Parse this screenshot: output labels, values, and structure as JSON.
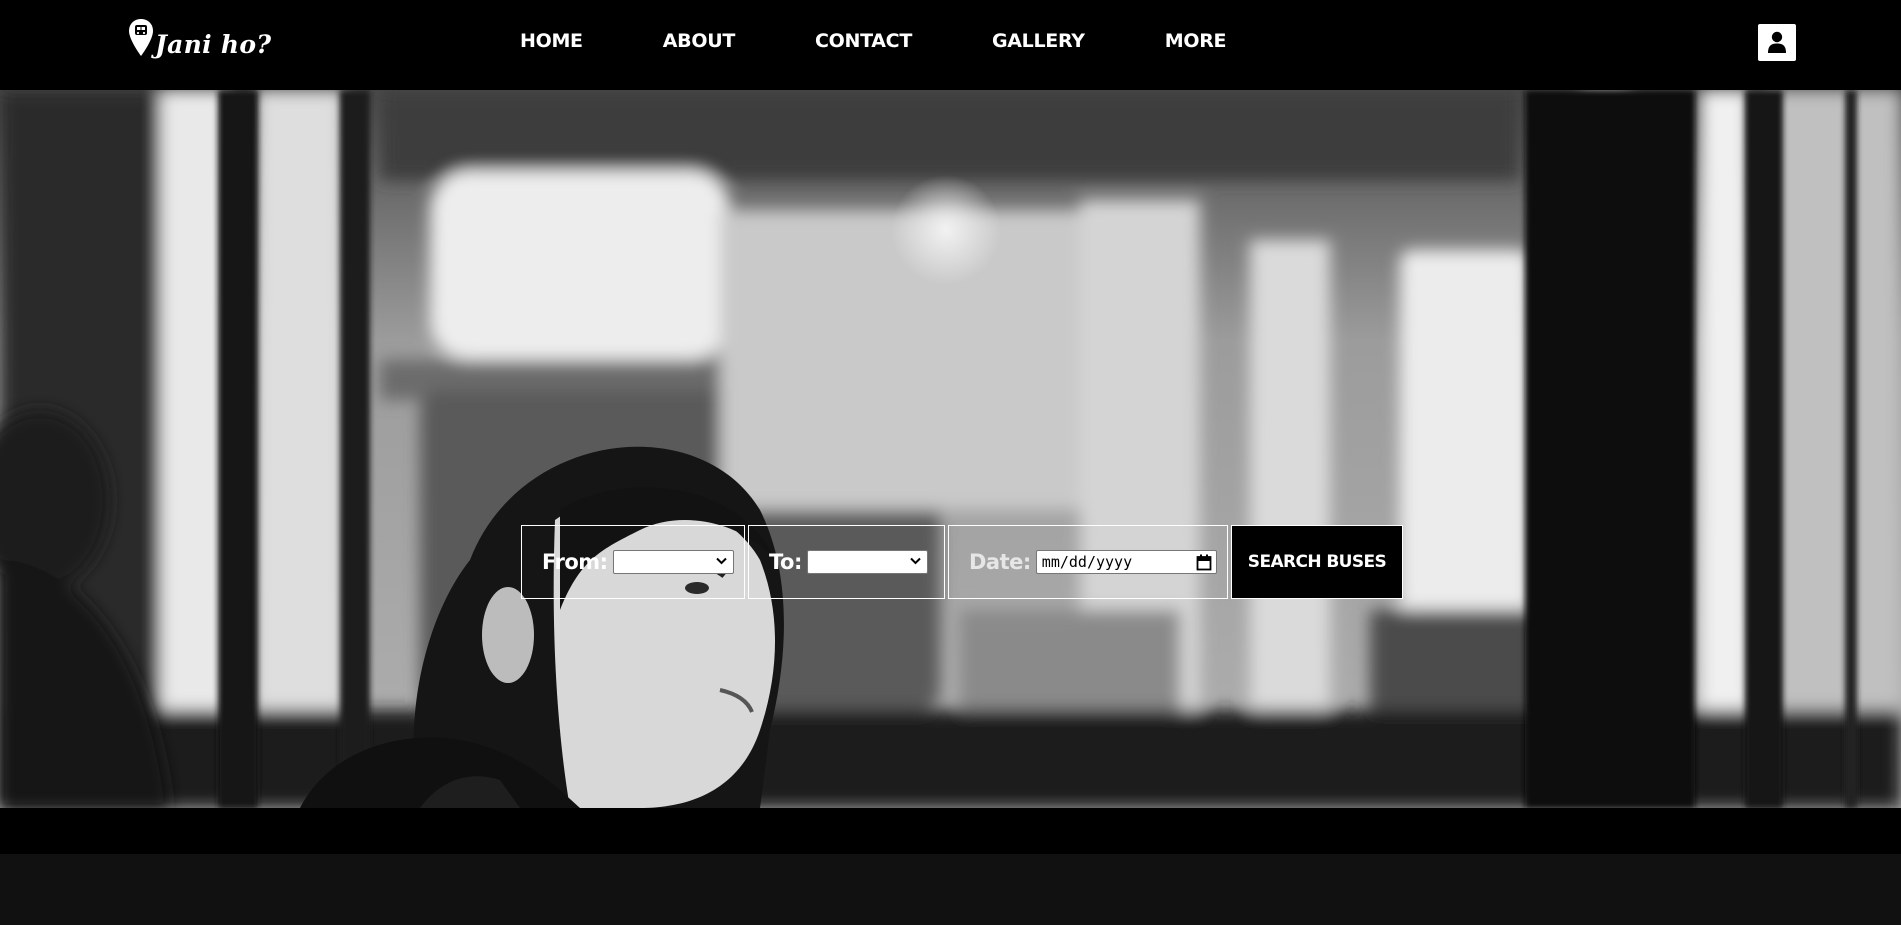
{
  "brand": {
    "name": "Jani ho?",
    "logo_icon": "map-pin-bus-icon"
  },
  "nav": {
    "items": [
      {
        "label": "HOME"
      },
      {
        "label": "ABOUT"
      },
      {
        "label": "CONTACT"
      },
      {
        "label": "GALLERY"
      },
      {
        "label": "MORE"
      }
    ]
  },
  "header": {
    "user_icon": "user-icon"
  },
  "search": {
    "from_label": "From:",
    "from_value": "",
    "to_label": "To:",
    "to_value": "",
    "date_label": "Date:",
    "date_placeholder": "mm/dd/yyyy",
    "date_icon": "calendar-icon",
    "button_label": "SEARCH BUSES"
  },
  "colors": {
    "header_bg": "#000000",
    "text": "#ffffff",
    "button_bg": "#000000",
    "footer_band": "#111111"
  }
}
